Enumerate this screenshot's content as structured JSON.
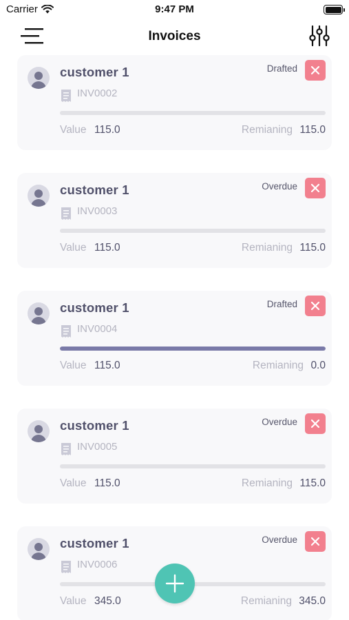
{
  "status_bar": {
    "carrier": "Carrier",
    "time": "9:47 PM"
  },
  "header": {
    "title": "Invoices"
  },
  "labels": {
    "value": "Value",
    "remaining": "Remianing"
  },
  "colors": {
    "accent": "#4fc4b4",
    "delete": "#f2808e",
    "progress_fill": "#7a7aa8",
    "progress_track": "#e2e2e6"
  },
  "invoices": [
    {
      "customer": "customer 1",
      "number": "INV0002",
      "status": "Drafted",
      "value": "115.0",
      "remaining": "115.0",
      "paid_fraction": 0
    },
    {
      "customer": "customer 1",
      "number": "INV0003",
      "status": "Overdue",
      "value": "115.0",
      "remaining": "115.0",
      "paid_fraction": 0
    },
    {
      "customer": "customer 1",
      "number": "INV0004",
      "status": "Drafted",
      "value": "115.0",
      "remaining": "0.0",
      "paid_fraction": 1
    },
    {
      "customer": "customer 1",
      "number": "INV0005",
      "status": "Overdue",
      "value": "115.0",
      "remaining": "115.0",
      "paid_fraction": 0
    },
    {
      "customer": "customer 1",
      "number": "INV0006",
      "status": "Overdue",
      "value": "345.0",
      "remaining": "345.0",
      "paid_fraction": 0
    }
  ],
  "icons": {
    "menu": "hamburger-menu-icon",
    "filter": "sliders-filter-icon",
    "avatar": "user-avatar-icon",
    "invoice": "receipt-icon",
    "delete": "close-x-icon",
    "fab": "plus-icon"
  }
}
